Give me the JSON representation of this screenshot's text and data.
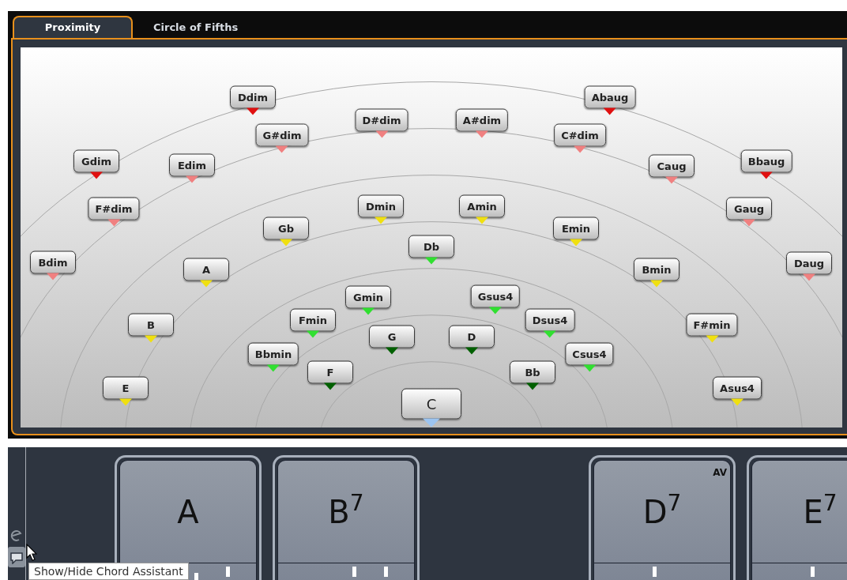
{
  "tabs": [
    {
      "label": "Proximity",
      "selected": true
    },
    {
      "label": "Circle of Fifths",
      "selected": false
    }
  ],
  "chords": [
    {
      "label": "Ddim",
      "color": "#e01010",
      "selected": false
    },
    {
      "label": "Abaug",
      "color": "#e01010",
      "selected": false
    },
    {
      "label": "D#dim",
      "color": "#f08080",
      "selected": false
    },
    {
      "label": "A#dim",
      "color": "#f08080",
      "selected": false
    },
    {
      "label": "G#dim",
      "color": "#f08080",
      "selected": false
    },
    {
      "label": "C#dim",
      "color": "#f08080",
      "selected": false
    },
    {
      "label": "Gdim",
      "color": "#e01010",
      "selected": false
    },
    {
      "label": "Edim",
      "color": "#f08080",
      "selected": false
    },
    {
      "label": "Caug",
      "color": "#f08080",
      "selected": false
    },
    {
      "label": "Bbaug",
      "color": "#e01010",
      "selected": false
    },
    {
      "label": "F#dim",
      "color": "#f08080",
      "selected": false
    },
    {
      "label": "Dmin",
      "color": "#f0e010",
      "selected": false
    },
    {
      "label": "Amin",
      "color": "#f0e010",
      "selected": false
    },
    {
      "label": "Gaug",
      "color": "#f08080",
      "selected": false
    },
    {
      "label": "Gb",
      "color": "#f0e010",
      "selected": false
    },
    {
      "label": "Emin",
      "color": "#f0e010",
      "selected": false
    },
    {
      "label": "Bdim",
      "color": "#f08080",
      "selected": false
    },
    {
      "label": "Db",
      "color": "#30e030",
      "selected": false
    },
    {
      "label": "Daug",
      "color": "#f08080",
      "selected": false
    },
    {
      "label": "A",
      "color": "#f0e010",
      "selected": false
    },
    {
      "label": "Bmin",
      "color": "#f0e010",
      "selected": false
    },
    {
      "label": "Gmin",
      "color": "#30e030",
      "selected": false
    },
    {
      "label": "Gsus4",
      "color": "#30e030",
      "selected": false
    },
    {
      "label": "Fmin",
      "color": "#30e030",
      "selected": false
    },
    {
      "label": "Dsus4",
      "color": "#30e030",
      "selected": false
    },
    {
      "label": "B",
      "color": "#f0e010",
      "selected": false
    },
    {
      "label": "F#min",
      "color": "#f0e010",
      "selected": false
    },
    {
      "label": "G",
      "color": "#006000",
      "selected": false
    },
    {
      "label": "D",
      "color": "#006000",
      "selected": false
    },
    {
      "label": "Bbmin",
      "color": "#30e030",
      "selected": false
    },
    {
      "label": "Csus4",
      "color": "#30e030",
      "selected": false
    },
    {
      "label": "F",
      "color": "#006000",
      "selected": false
    },
    {
      "label": "Bb",
      "color": "#006000",
      "selected": false
    },
    {
      "label": "E",
      "color": "#f0e010",
      "selected": false
    },
    {
      "label": "Asus4",
      "color": "#f0e010",
      "selected": false
    },
    {
      "label": "C",
      "color": "#9cc4f0",
      "selected": true
    }
  ],
  "pads": [
    {
      "kind": "chord",
      "label": "A"
    },
    {
      "kind": "chord",
      "label": "B$^{7}$"
    },
    {
      "kind": "empty"
    },
    {
      "kind": "chord",
      "label": "D$^{7}$",
      "tag": "AV"
    },
    {
      "kind": "chord",
      "label": "E$^{7}$"
    }
  ],
  "tooltip": "Show/Hide Chord Assistant"
}
